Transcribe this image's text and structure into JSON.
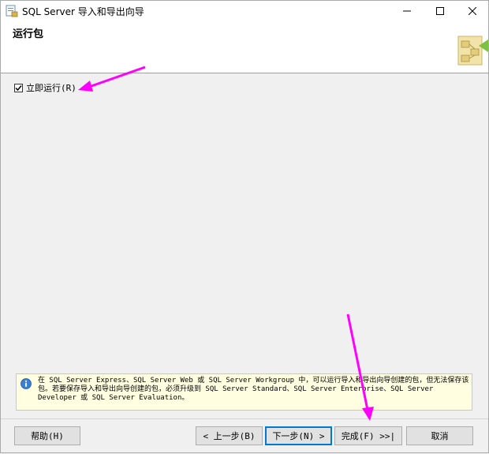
{
  "titlebar": {
    "title": "SQL Server 导入和导出向导",
    "minimize_glyph": "—",
    "maximize_glyph": "□",
    "close_glyph": "✕"
  },
  "header": {
    "title": "运行包"
  },
  "options": {
    "run_immediately_label": "立即运行(R)",
    "run_immediately_checked": true
  },
  "info": {
    "icon": "info-icon",
    "text": "在 SQL Server Express、SQL Server Web 或 SQL Server Workgroup 中，可以运行导入和导出向导创建的包，但无法保存该包。若要保存导入和导出向导创建的包，必须升级到 SQL Server Standard、SQL Server Enterprise、SQL Server Developer 或 SQL Server Evaluation。"
  },
  "buttons": {
    "help": "帮助(H)",
    "back": "< 上一步(B)",
    "next": "下一步(N) >",
    "finish": "完成(F) >>|",
    "cancel": "取消"
  },
  "colors": {
    "annotation": "#ff00ff",
    "info_background": "#fffee1",
    "default_button_border": "#0078d7"
  }
}
